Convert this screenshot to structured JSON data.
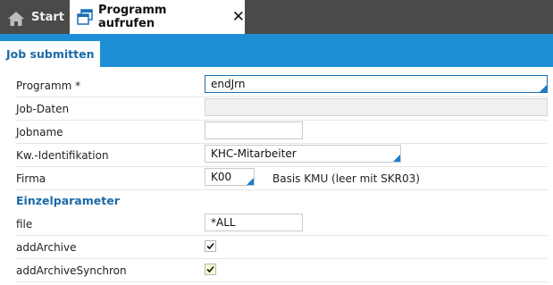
{
  "tabs": {
    "start_label": "Start",
    "active_label": "Programm aufrufen"
  },
  "section": {
    "tab_label": "Job submitten"
  },
  "form": {
    "programm": {
      "label": "Programm *",
      "value": "endJrn"
    },
    "jobdaten": {
      "label": "Job-Daten",
      "value": ""
    },
    "jobname": {
      "label": "Jobname",
      "value": ""
    },
    "kw": {
      "label": "Kw.-Identifikation",
      "value": "KHC-Mitarbeiter"
    },
    "firma": {
      "label": "Firma",
      "value": "K00",
      "description": "Basis KMU (leer mit SKR03)"
    }
  },
  "einzelparameter": {
    "title": "Einzelparameter",
    "file": {
      "label": "file",
      "value": "*ALL"
    },
    "addArchive": {
      "label": "addArchive",
      "checked": true
    },
    "addArchiveSynchron": {
      "label": "addArchiveSynchron",
      "checked": true
    }
  },
  "colors": {
    "accent": "#1e8fd6",
    "header_dark": "#4a4a4a",
    "section_text": "#1a6aa8"
  }
}
